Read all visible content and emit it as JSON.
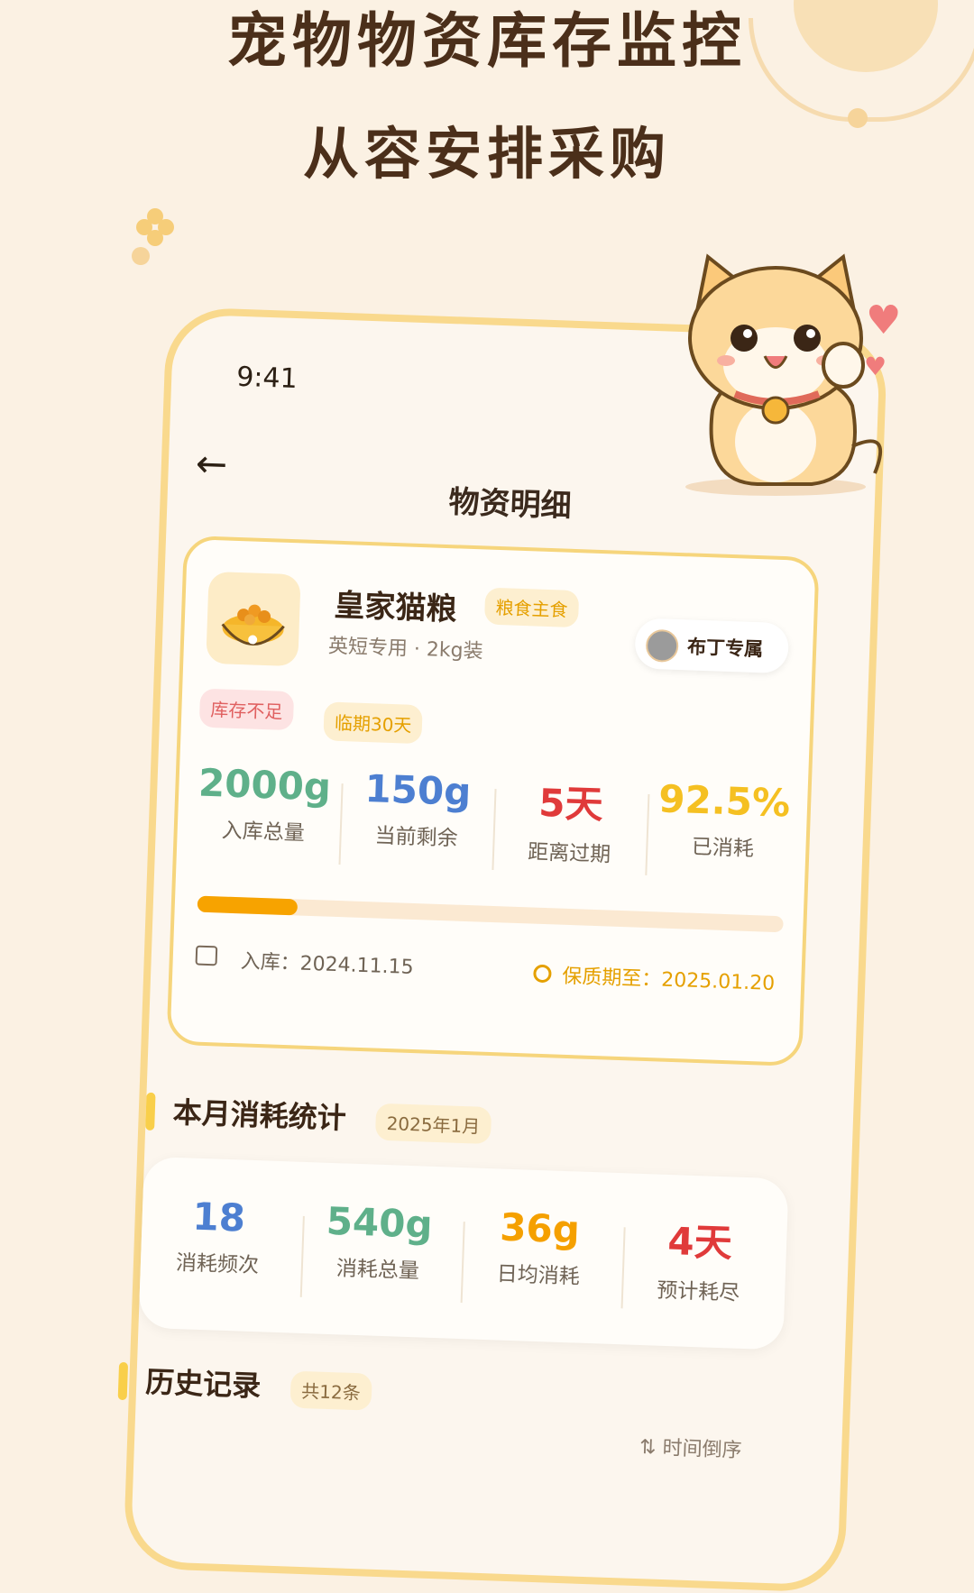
{
  "headline": {
    "line1": "宠物物资库存监控",
    "line2": "从容安排采购"
  },
  "status_bar": {
    "time": "9:41"
  },
  "nav": {
    "back_icon": "←",
    "title": "物资明细"
  },
  "product": {
    "name": "皇家猫粮",
    "category_tag": "粮食主食",
    "subtitle": "英短专用 · 2kg装",
    "owner_label": "布丁专属",
    "badges": [
      "库存不足",
      "临期30天"
    ],
    "stats": [
      {
        "value": "2000g",
        "label": "入库总量",
        "color": "#5fb08a"
      },
      {
        "value": "150g",
        "label": "当前剩余",
        "color": "#4d7fd1"
      },
      {
        "value": "5天",
        "label": "距离过期",
        "color": "#e03a3a"
      },
      {
        "value": "92.5%",
        "label": "已消耗",
        "color": "#f5c022"
      }
    ],
    "remaining_fraction": 0.17,
    "stock_in": "入库：2024.11.15",
    "expiry": "保质期至：2025.01.20"
  },
  "monthly": {
    "title": "本月消耗统计",
    "period": "2025年1月",
    "stats": [
      {
        "value": "18",
        "label": "消耗频次",
        "color": "#4d7fd1"
      },
      {
        "value": "540g",
        "label": "消耗总量",
        "color": "#5fb08a"
      },
      {
        "value": "36g",
        "label": "日均消耗",
        "color": "#f5a000"
      },
      {
        "value": "4天",
        "label": "预计耗尽",
        "color": "#e03a3a"
      }
    ]
  },
  "history": {
    "title": "历史记录",
    "count": "共12条",
    "sort_label": "时间倒序"
  },
  "icons": [
    "arrow-left-icon",
    "food-bowl-icon",
    "calendar-icon",
    "clock-icon",
    "sort-icon",
    "cat-mascot",
    "heart-icon"
  ]
}
